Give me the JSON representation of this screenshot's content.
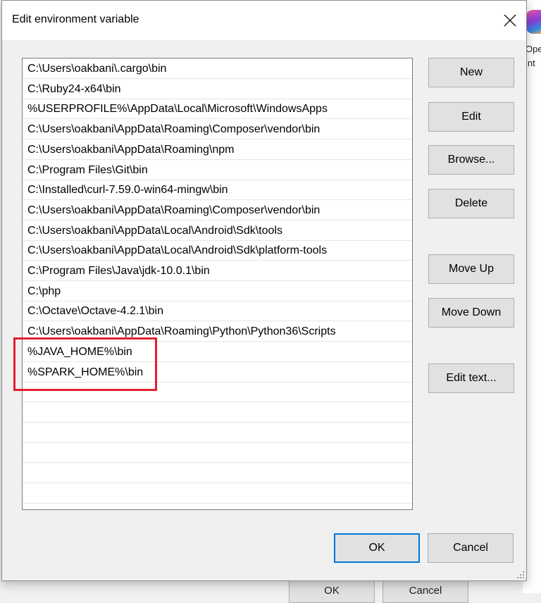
{
  "dialog": {
    "title": "Edit environment variable"
  },
  "paths": [
    "C:\\Users\\oakbani\\.cargo\\bin",
    "C:\\Ruby24-x64\\bin",
    "%USERPROFILE%\\AppData\\Local\\Microsoft\\WindowsApps",
    "C:\\Users\\oakbani\\AppData\\Roaming\\Composer\\vendor\\bin",
    "C:\\Users\\oakbani\\AppData\\Roaming\\npm",
    "C:\\Program Files\\Git\\bin",
    "C:\\Installed\\curl-7.59.0-win64-mingw\\bin",
    "C:\\Users\\oakbani\\AppData\\Roaming\\Composer\\vendor\\bin",
    "C:\\Users\\oakbani\\AppData\\Local\\Android\\Sdk\\tools",
    "C:\\Users\\oakbani\\AppData\\Local\\Android\\Sdk\\platform-tools",
    "C:\\Program Files\\Java\\jdk-10.0.1\\bin",
    "C:\\php",
    "C:\\Octave\\Octave-4.2.1\\bin",
    "C:\\Users\\oakbani\\AppData\\Roaming\\Python\\Python36\\Scripts",
    "%JAVA_HOME%\\bin",
    "%SPARK_HOME%\\bin",
    "",
    "",
    "",
    "",
    "",
    ""
  ],
  "buttons": {
    "new": "New",
    "edit": "Edit",
    "browse": "Browse...",
    "delete": "Delete",
    "move_up": "Move Up",
    "move_down": "Move Down",
    "edit_text": "Edit text...",
    "ok": "OK",
    "cancel": "Cancel"
  },
  "background": {
    "side_text_1": "Ope",
    "side_text_2": "int",
    "bottom_ok": "OK",
    "bottom_cancel": "Cancel"
  },
  "colors": {
    "highlight": "#e0202e",
    "focus_border": "#0078d7"
  }
}
